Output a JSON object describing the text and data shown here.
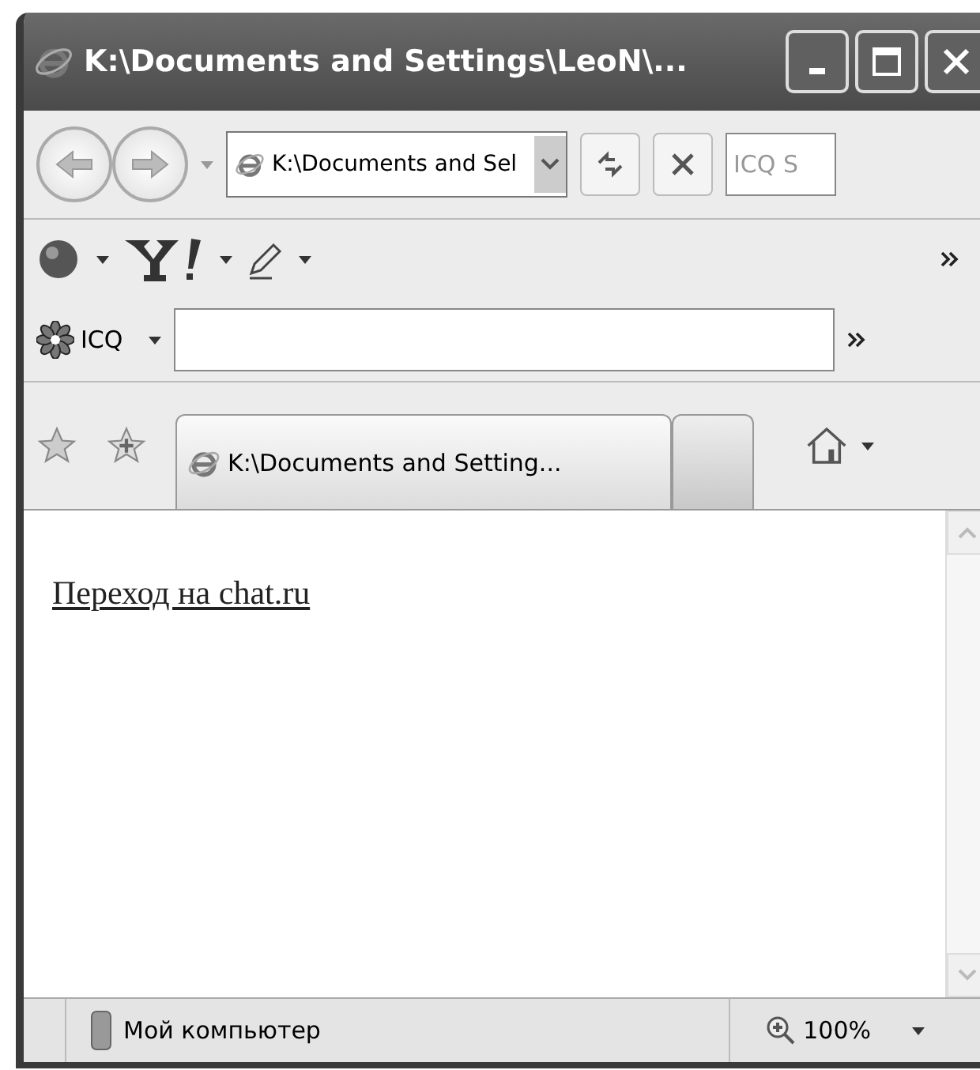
{
  "window": {
    "title": "K:\\Documents and Settings\\LeoN\\..."
  },
  "address_bar": {
    "value": "K:\\Documents and Sel"
  },
  "search": {
    "placeholder": "ICQ S"
  },
  "icq_toolbar": {
    "label": "ICQ"
  },
  "tabs": [
    {
      "label": "K:\\Documents and Setting...",
      "selected": true
    },
    {
      "selected": false
    }
  ],
  "content": {
    "link": "Переход на chat.ru"
  },
  "status_bar": {
    "zone": "Мой компьютер",
    "zoom": "100%"
  }
}
